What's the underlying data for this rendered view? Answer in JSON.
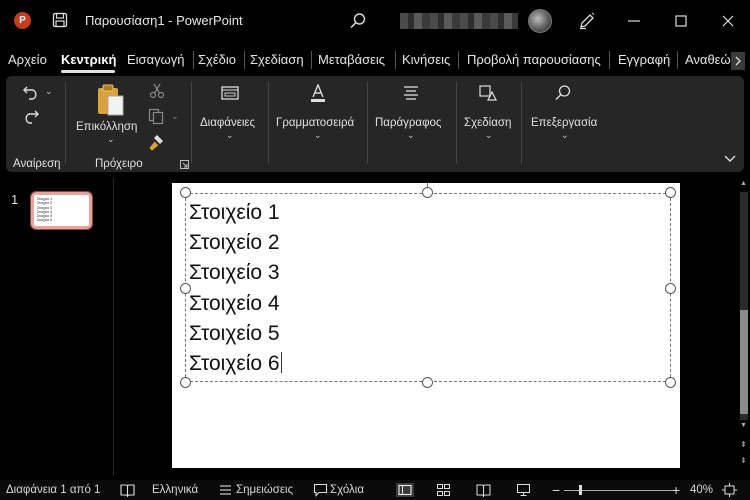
{
  "titlebar": {
    "app_logo": "P",
    "title": "Παρουσίαση1  -  PowerPoint"
  },
  "menu": {
    "tabs": [
      "Αρχείο",
      "Κεντρική",
      "Εισαγωγή",
      "Σχέδιο",
      "Σχεδίαση",
      "Μεταβάσεις",
      "Κινήσεις",
      "Προβολή παρουσίασης",
      "Εγγραφή",
      "Αναθεώ"
    ],
    "active_index": 1
  },
  "ribbon": {
    "groups": {
      "undo": "Αναίρεση",
      "clipboard": "Πρόχειρο",
      "paste": "Επικόλληση",
      "slides": "Διαφάνειες",
      "font": "Γραμματοσειρά",
      "paragraph": "Παράγραφος",
      "drawing": "Σχεδίαση",
      "editing": "Επεξεργασία"
    }
  },
  "thumbnails": {
    "slide_number": "1"
  },
  "slide": {
    "lines": [
      "Στοιχείο 1",
      "Στοιχείο 2",
      "Στοιχείο 3",
      "Στοιχείο 4",
      "Στοιχείο 5",
      "Στοιχείο 6"
    ]
  },
  "status": {
    "slide_info": "Διαφάνεια 1 από 1",
    "language": "Ελληνικά",
    "notes": "Σημειώσεις",
    "comments": "Σχόλια",
    "zoom": "40%"
  },
  "colors": {
    "accent_logo": "#c43e1c",
    "thumb_border": "#e8a39c",
    "ribbon_bg": "#262626"
  }
}
